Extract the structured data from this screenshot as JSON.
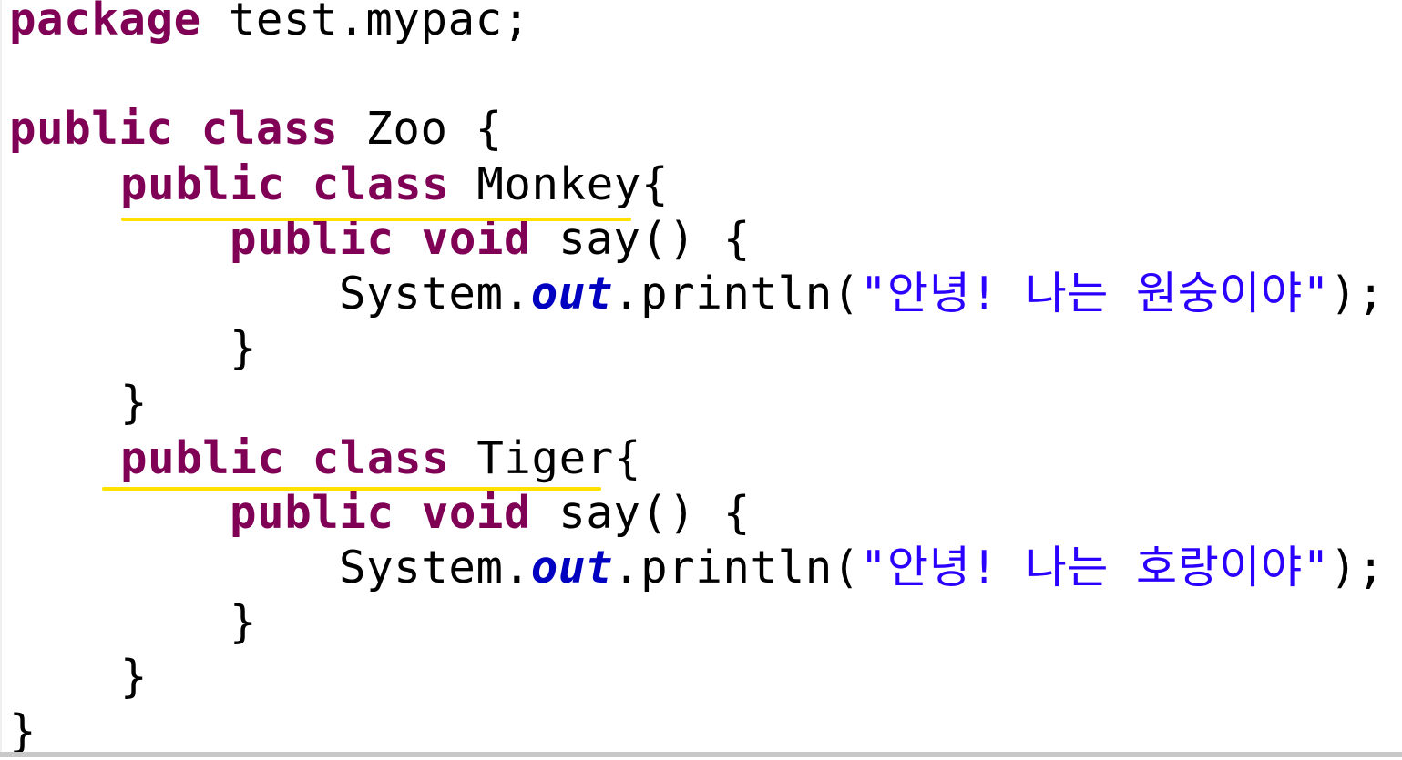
{
  "editor": {
    "language": "java",
    "colors": {
      "keyword": "#7f0055",
      "static_field": "#0000c0",
      "string": "#2a00ff",
      "text": "#000000",
      "annotation_underline": "#ffe100"
    },
    "lines": [
      {
        "kw": "package",
        "rest": " test.mypac;"
      },
      {
        "text": ""
      },
      {
        "kw1": "public",
        "kw2": "class",
        "rest": " Zoo {"
      },
      {
        "kw1": "public",
        "kw2": "class",
        "rest": " Monkey{"
      },
      {
        "kw1": "public",
        "kw2": "void",
        "rest": " say() {"
      },
      {
        "pre": "System.",
        "field": "out",
        "mid": ".println(",
        "str": "\"안녕! 나는 원숭이야\"",
        "post": ");"
      },
      {
        "text": "}"
      },
      {
        "text": "}"
      },
      {
        "kw1": "public",
        "kw2": "class",
        "rest": " Tiger{"
      },
      {
        "kw1": "public",
        "kw2": "void",
        "rest": " say() {"
      },
      {
        "pre": "System.",
        "field": "out",
        "mid": ".println(",
        "str": "\"안녕! 나는 호랑이야\"",
        "post": ");"
      },
      {
        "text": "}"
      },
      {
        "text": "}"
      },
      {
        "text": "}"
      }
    ],
    "annotations": [
      {
        "target": "public class Monkey",
        "style": "yellow-underline"
      },
      {
        "target": "public class Tiger",
        "style": "yellow-underline"
      }
    ]
  }
}
